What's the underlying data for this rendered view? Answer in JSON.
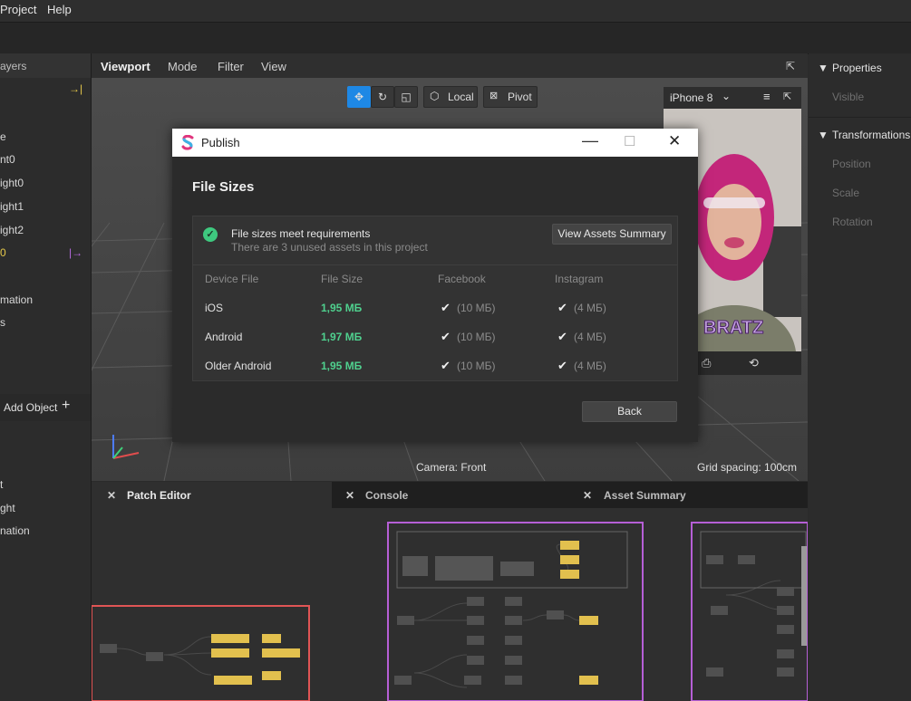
{
  "menubar": {
    "items": [
      "Project",
      "Help"
    ]
  },
  "left_panel": {
    "header": "ayers",
    "items": [
      "e",
      "nt0",
      "ight0",
      "ight1",
      "ight2",
      "0",
      "mation",
      "s"
    ],
    "add_object": "Add Object",
    "lower_items": [
      "t",
      "ght",
      "nation"
    ]
  },
  "viewport": {
    "tabs": [
      "Viewport",
      "Mode",
      "Filter",
      "View"
    ],
    "local_label": "Local",
    "pivot_label": "Pivot",
    "camera_label": "Camera: Front",
    "grid_label": "Grid spacing: 100cm"
  },
  "preview": {
    "device": "iPhone 8"
  },
  "right_panel": {
    "properties": "Properties",
    "visible": "Visible",
    "transformations": "Transformations",
    "position": "Position",
    "scale": "Scale",
    "rotation": "Rotation"
  },
  "bottom_tabs": [
    "Patch Editor",
    "Console",
    "Asset Summary"
  ],
  "dialog": {
    "title": "Publish",
    "heading": "File Sizes",
    "status_title": "File sizes meet requirements",
    "status_sub": "There are 3 unused assets in this project",
    "view_assets_button": "View Assets Summary",
    "columns": [
      "Device File",
      "File Size",
      "Facebook",
      "Instagram"
    ],
    "rows": [
      {
        "device": "iOS",
        "size": "1,95 МБ",
        "facebook": "(10 МБ)",
        "instagram": "(4 МБ)"
      },
      {
        "device": "Android",
        "size": "1,97 МБ",
        "facebook": "(10 МБ)",
        "instagram": "(4 МБ)"
      },
      {
        "device": "Older Android",
        "size": "1,95 МБ",
        "facebook": "(10 МБ)",
        "instagram": "(4 МБ)"
      }
    ],
    "back_button": "Back"
  },
  "colors": {
    "accent_blue": "#1e88e5",
    "success_green": "#4fd08e",
    "node_yellow": "#e2c04e",
    "group_purple": "#b65fd6",
    "group_red": "#e05555"
  }
}
